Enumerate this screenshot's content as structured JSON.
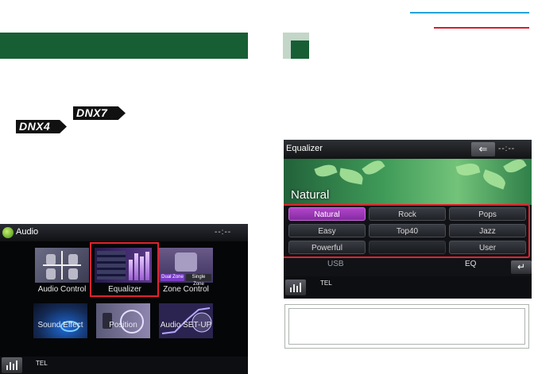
{
  "colors": {
    "section_green": "#175e35",
    "header_blue": "#23a3dc",
    "header_red": "#d81b2a",
    "highlight_red": "#e0232e",
    "active_preset_purple": "#b146c8"
  },
  "badges": {
    "model_1": "DNX7",
    "model_2": "DNX4"
  },
  "audio_screen": {
    "title": "Audio",
    "clock": "--:--",
    "tiles": [
      {
        "label": "Audio Control",
        "icon": "audio-control-icon"
      },
      {
        "label": "Equalizer",
        "icon": "equalizer-icon"
      },
      {
        "label": "Zone Control",
        "icon": "zone-control-icon"
      },
      {
        "label": "Sound Effect",
        "icon": "sound-effect-icon"
      },
      {
        "label": "Position",
        "icon": "position-icon"
      },
      {
        "label": "Audio SET-UP",
        "icon": "audio-setup-icon"
      }
    ],
    "zone_buttons": [
      "Dual Zone",
      "Single Zone"
    ],
    "bottom": {
      "tel": "TEL"
    }
  },
  "equalizer_screen": {
    "title": "Equalizer",
    "clock": "--:--",
    "back_icon": "back-arrow-icon",
    "current_preset": "Natural",
    "presets": [
      "Natural",
      "Rock",
      "Pops",
      "Easy",
      "Top40",
      "Jazz",
      "Powerful",
      "",
      "User"
    ],
    "selected_preset": "Natural",
    "usb_label": "USB",
    "eq_label": "EQ",
    "bottom": {
      "tel": "TEL"
    }
  }
}
